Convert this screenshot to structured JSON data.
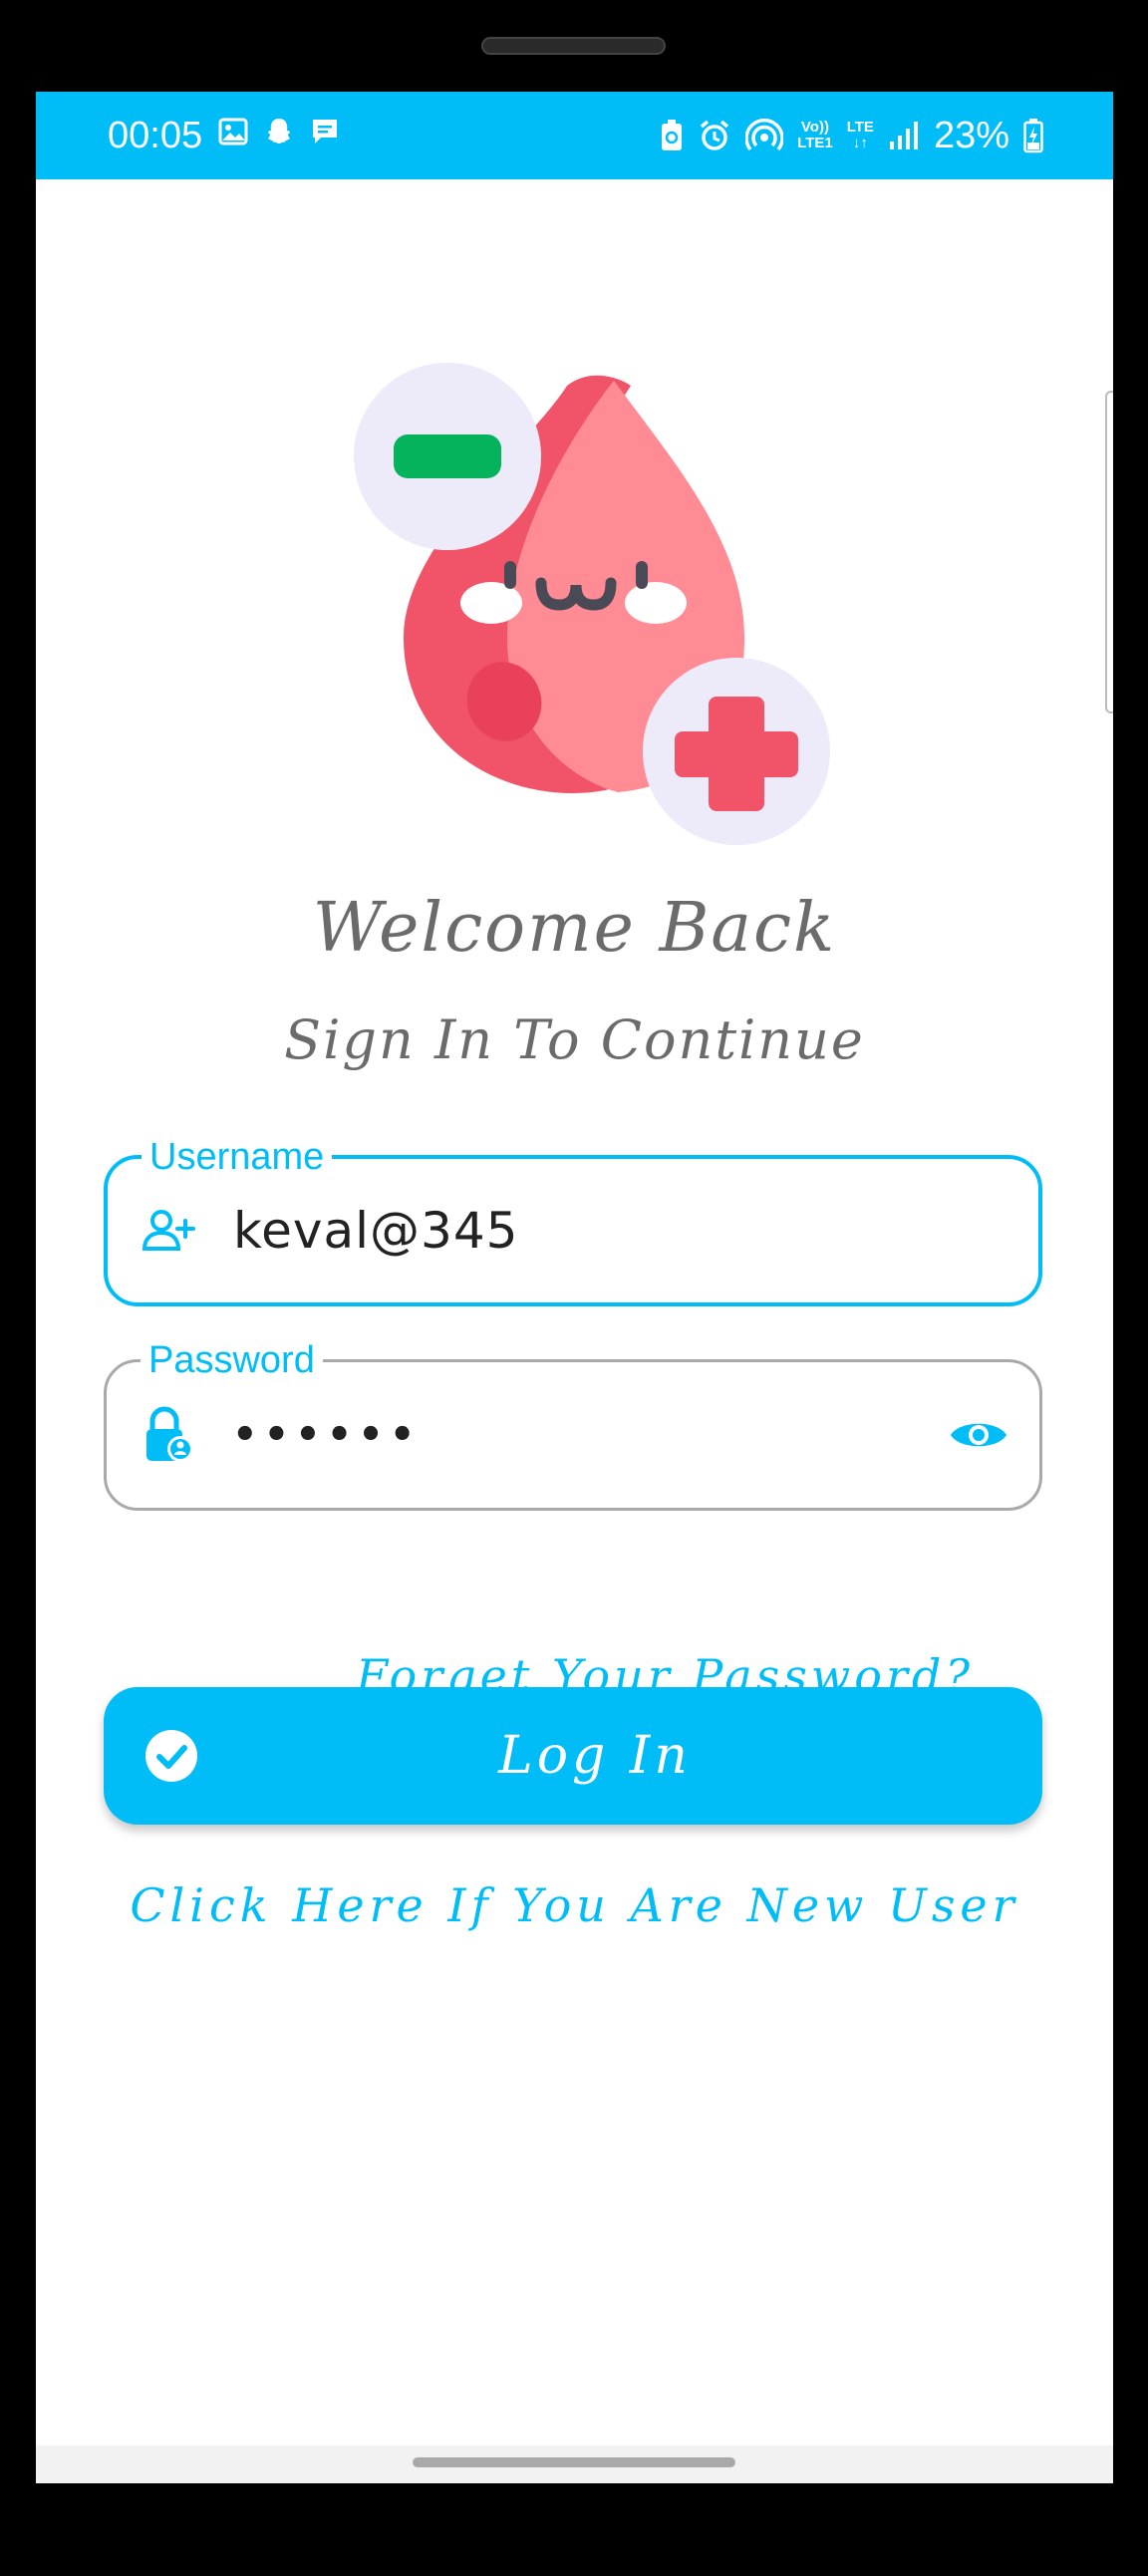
{
  "status_bar": {
    "time": "00:05",
    "battery_percent": "23%",
    "network_top": "Vo))",
    "network_bottom": "LTE1",
    "lte_label": "LTE",
    "icons_left": [
      "image-icon",
      "snapchat-icon",
      "message-icon"
    ],
    "icons_right": [
      "recycle-battery-icon",
      "alarm-icon",
      "hotspot-icon",
      "volte-icon",
      "lte-icon",
      "signal-icon",
      "battery-charging-icon"
    ],
    "color": "#00BDF8"
  },
  "hero": {
    "illustration": "blood-drop-mascot-icon"
  },
  "welcome": {
    "title": "Welcome Back",
    "subtitle": "Sign In To Continue"
  },
  "form": {
    "username": {
      "label": "Username",
      "value": "keval@345",
      "icon": "add-user-icon"
    },
    "password": {
      "label": "Password",
      "value": "••••••",
      "icon": "lock-user-icon",
      "toggle_icon": "eye-icon"
    },
    "forgot_link": "Forget Your Password?",
    "login_label": "Log In",
    "login_icon": "check-circle-icon",
    "new_user_link": "Click Here If You Are New User"
  },
  "colors": {
    "accent": "#00BDF8",
    "text_muted": "#6b6b6b",
    "drop": "#FF8B94",
    "drop_shade": "#F15468",
    "badge_bg": "#EDEBFA",
    "minus_badge": "#05B35D",
    "plus_badge": "#F15468"
  }
}
